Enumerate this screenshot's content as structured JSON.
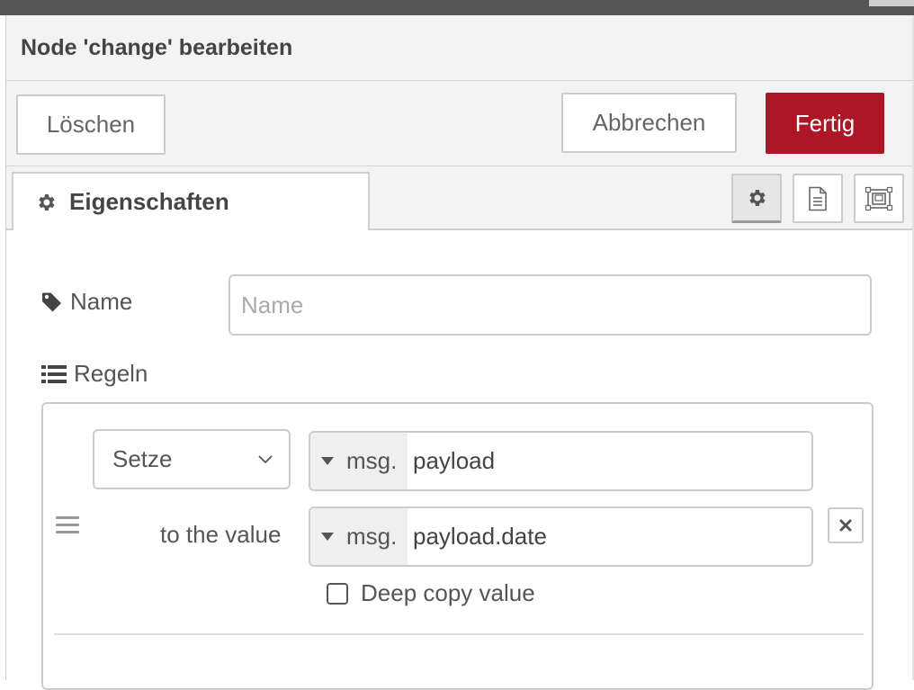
{
  "dialog": {
    "title": "Node 'change' bearbeiten"
  },
  "toolbar": {
    "delete_label": "Löschen",
    "cancel_label": "Abbrechen",
    "done_label": "Fertig"
  },
  "tabs": {
    "active_label": "Eigenschaften",
    "icons": [
      "gear-icon",
      "description-icon",
      "appearance-icon"
    ]
  },
  "form": {
    "name_label": "Name",
    "name_placeholder": "Name",
    "name_value": "",
    "rules_label": "Regeln"
  },
  "rule": {
    "action": "Setze",
    "target_type": "msg.",
    "target_value": "payload",
    "to_value_label": "to the value",
    "value_type": "msg.",
    "value_value": "payload.date",
    "deep_copy_label": "Deep copy value",
    "deep_copy_checked": false
  },
  "colors": {
    "primary_button": "#ad1625",
    "header_bg": "#f3f3f3",
    "border": "#cccccc"
  }
}
